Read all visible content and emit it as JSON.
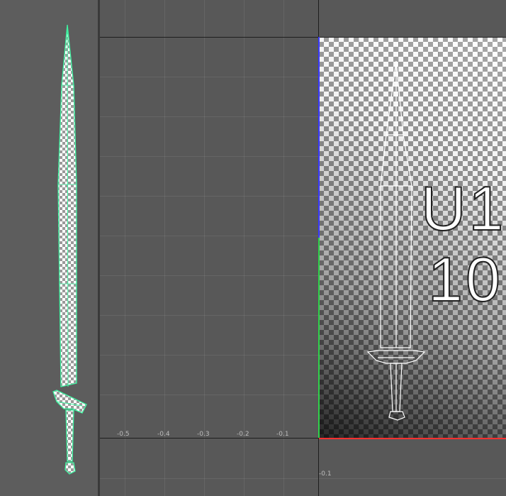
{
  "uv_editor": {
    "u_axis_labels": [
      "-0.5",
      "-0.4",
      "-0.3",
      "-0.2",
      "-0.1"
    ],
    "v_axis_labels": [
      "-0.1"
    ],
    "tile_label_line1": "U1",
    "tile_label_line2": "10",
    "axis_colors": {
      "u": "#ff3030",
      "v": "#3a3aff",
      "v_lower": "#2fd24a"
    }
  },
  "viewport": {
    "selection_color": "#3ef2a0"
  }
}
